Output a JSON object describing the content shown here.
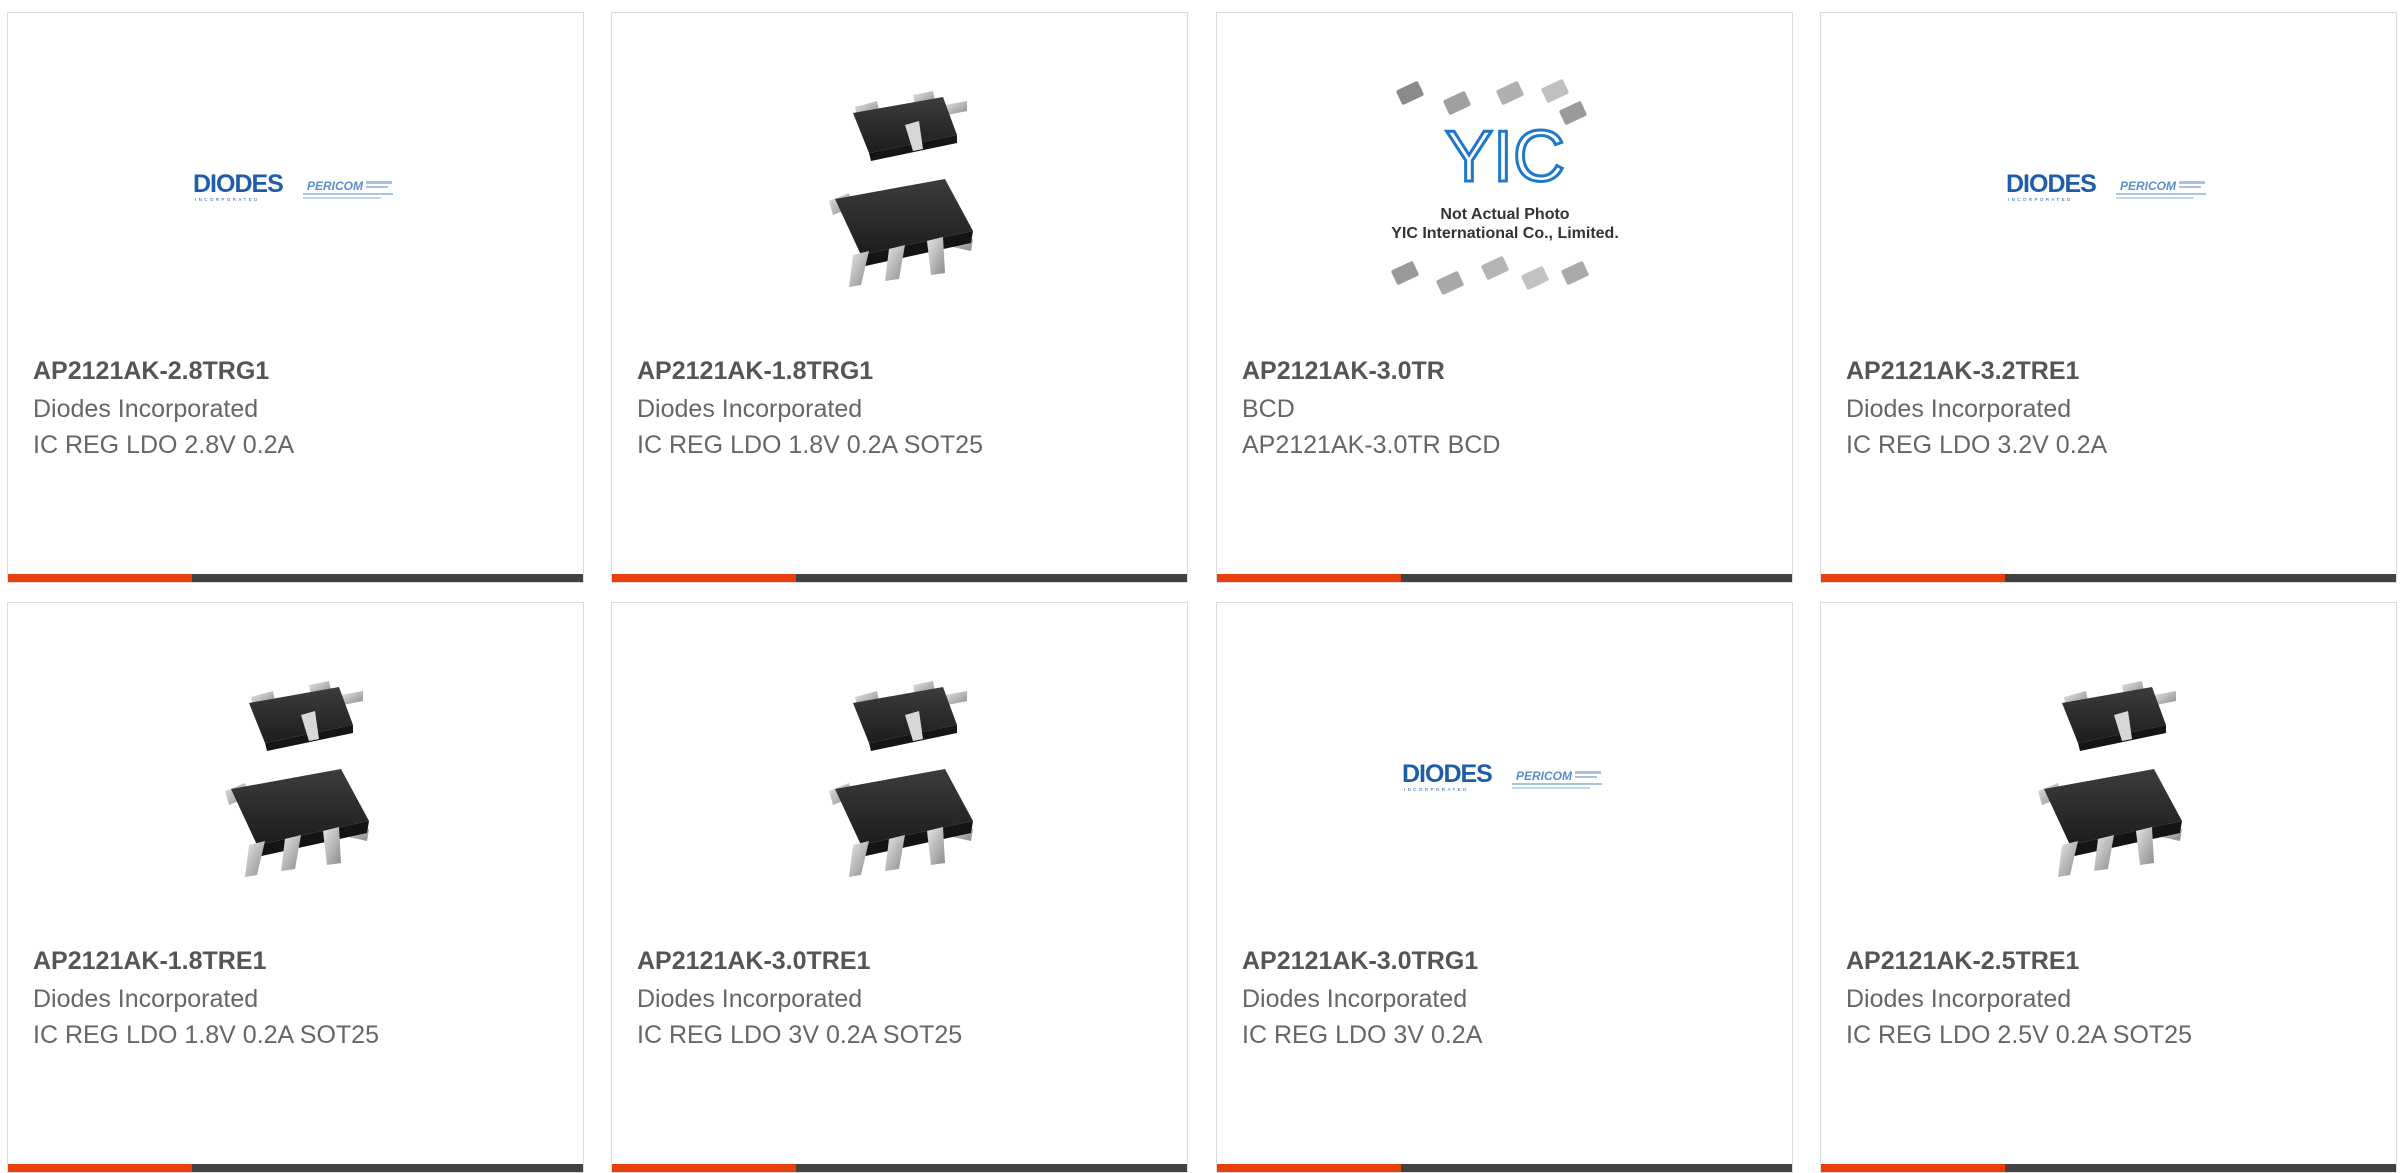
{
  "accent_color": "#e8400c",
  "bar_color": "#424242",
  "products": [
    {
      "part": "AP2121AK-2.8TRG1",
      "manufacturer": "Diodes Incorporated",
      "description": "IC REG LDO 2.8V 0.2A",
      "image": "diodes-logo"
    },
    {
      "part": "AP2121AK-1.8TRG1",
      "manufacturer": "Diodes Incorporated",
      "description": "IC REG LDO 1.8V 0.2A SOT25",
      "image": "sot25-package"
    },
    {
      "part": "AP2121AK-3.0TR",
      "manufacturer": "BCD",
      "description": "AP2121AK-3.0TR BCD",
      "image": "yic-placeholder",
      "image_text": {
        "logo": "YIC",
        "line1": "Not Actual Photo",
        "line2": "YIC International Co., Limited."
      }
    },
    {
      "part": "AP2121AK-3.2TRE1",
      "manufacturer": "Diodes Incorporated",
      "description": "IC REG LDO 3.2V 0.2A",
      "image": "diodes-logo"
    },
    {
      "part": "AP2121AK-1.8TRE1",
      "manufacturer": "Diodes Incorporated",
      "description": "IC REG LDO 1.8V 0.2A SOT25",
      "image": "sot25-package"
    },
    {
      "part": "AP2121AK-3.0TRE1",
      "manufacturer": "Diodes Incorporated",
      "description": "IC REG LDO 3V 0.2A SOT25",
      "image": "sot25-package"
    },
    {
      "part": "AP2121AK-3.0TRG1",
      "manufacturer": "Diodes Incorporated",
      "description": "IC REG LDO 3V 0.2A",
      "image": "diodes-logo"
    },
    {
      "part": "AP2121AK-2.5TRE1",
      "manufacturer": "Diodes Incorporated",
      "description": "IC REG LDO 2.5V 0.2A SOT25",
      "image": "sot25-package"
    }
  ],
  "logo_text": {
    "diodes": "DIODES",
    "diodes_sub": "INCORPORATED",
    "pericom": "PERICOM"
  }
}
